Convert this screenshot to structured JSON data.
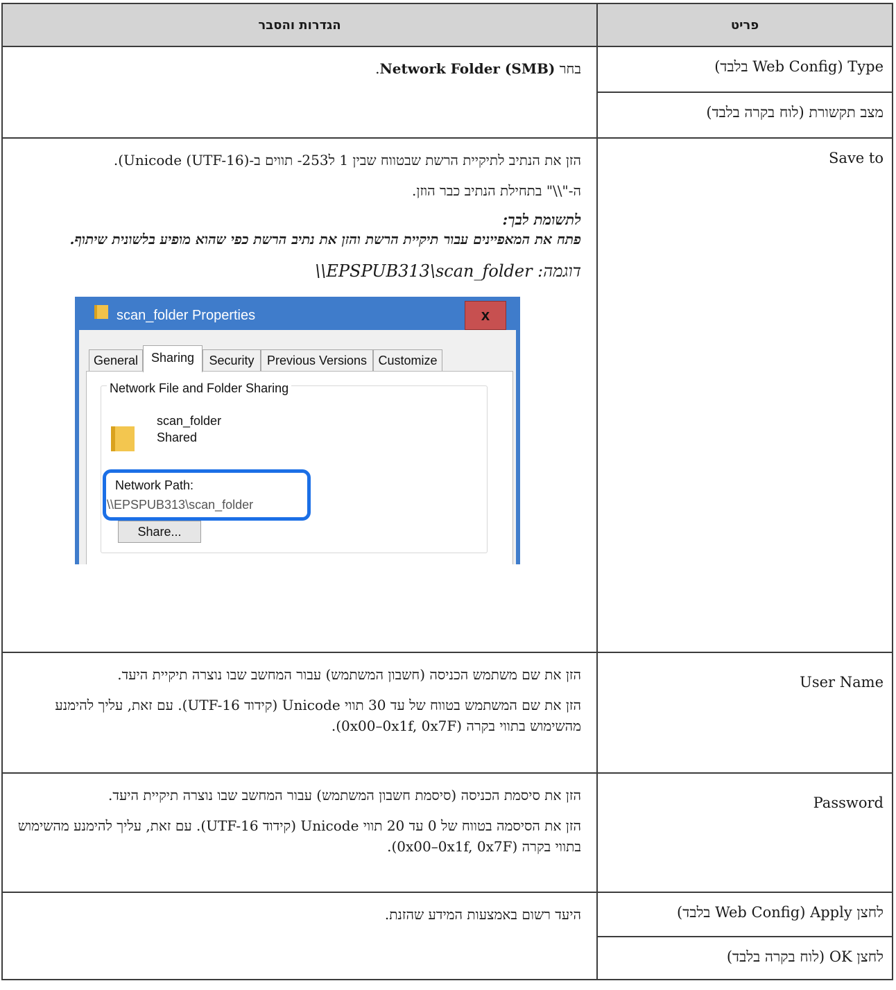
{
  "table": {
    "headers": {
      "item": "פריט",
      "settings": "הגדרות והסבר"
    },
    "rows": {
      "type": {
        "item": "Type (Web Config בלבד)",
        "desc_prefix": "בחר ",
        "desc_bold": "Network Folder (SMB)",
        "desc_suffix": "."
      },
      "comm_mode": {
        "item": "מצב תקשורת (לוח בקרה בלבד)"
      },
      "save_to": {
        "item": "Save to",
        "p1": "הזן את הנתיב לתיקיית הרשת שבטווח שבין 1 ל253- תווים ב-Unicode (UTF-16)).",
        "p2": "ה-\"\\\\\" בתחילת הנתיב כבר הוזן.",
        "note_title": "לתשומת לבך:",
        "note_body": "פתח את המאפיינים עבור תיקיית הרשת והזן את נתיב הרשת כפי שהוא מופיע בלשונית שיתוף.",
        "example_label": "דוגמה: ",
        "example_value": "\\\\EPSPUB313\\scan_folder"
      },
      "user_name": {
        "item": "User Name",
        "p1": "הזן את שם משתמש הכניסה (חשבון המשתמש) עבור המחשב שבו נוצרה תיקיית היעד.",
        "p2": "הזן את שם המשתמש בטווח של עד 30 תווי Unicode (קידוד UTF-16). עם זאת, עליך להימנע מהשימוש בתווי בקרה (0x00–0x1f, 0x7F)."
      },
      "password": {
        "item": "Password",
        "p1": "הזן את סיסמת הכניסה (סיסמת חשבון המשתמש) עבור המחשב שבו נוצרה תיקיית היעד.",
        "p2": "הזן את הסיסמה בטווח של 0 עד 20 תווי Unicode (קידוד UTF-16). עם זאת, עליך להימנע מהשימוש בתווי בקרה (0x00–0x1f, 0x7F)."
      },
      "apply": {
        "item": "לחצן Apply (Web Config בלבד)",
        "desc": "היעד רשום באמצעות המידע שהזנת."
      },
      "ok": {
        "item": "לחצן OK (לוח בקרה בלבד)"
      }
    }
  },
  "screenshot": {
    "title": "scan_folder Properties",
    "close_label": "x",
    "tabs": [
      "General",
      "Sharing",
      "Security",
      "Previous Versions",
      "Customize"
    ],
    "active_tab": "Sharing",
    "group_title": "Network File and Folder Sharing",
    "folder_name": "scan_folder",
    "folder_state": "Shared",
    "network_path_label": "Network Path:",
    "network_path_value": "\\\\EPSPUB313\\scan_folder",
    "share_button": "Share...",
    "colors": {
      "titlebar": "#3f7ccb",
      "close": "#c75050",
      "highlight": "#1b6fe6"
    }
  }
}
